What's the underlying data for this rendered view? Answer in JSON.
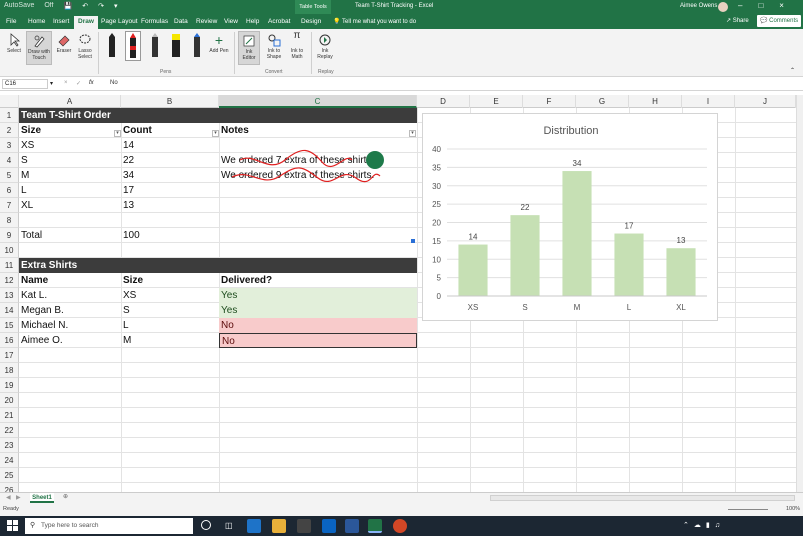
{
  "title_bar": {
    "autosave": "AutoSave",
    "autosave_state": "Off",
    "context_tab": "Table Tools",
    "title": "Team T-Shirt Tracking - Excel",
    "user": "Aimee Owens"
  },
  "tabs": [
    "File",
    "Home",
    "Insert",
    "Draw",
    "Page Layout",
    "Formulas",
    "Data",
    "Review",
    "View",
    "Help",
    "Acrobat",
    "Design"
  ],
  "active_tab": "Draw",
  "tell_me": "Tell me what you want to do",
  "share": "Share",
  "comments": "Comments",
  "ribbon": {
    "select": "Select",
    "draw_touch": "Draw with Touch",
    "eraser": "Eraser",
    "lasso": "Lasso Select",
    "add_pen": "Add Pen",
    "ink_editor": "Ink Editor",
    "ink_shape": "Ink to Shape",
    "ink_math": "Ink to Math",
    "ink_replay": "Ink Replay",
    "groups": {
      "pens": "Pens",
      "convert": "Convert",
      "replay": "Replay"
    }
  },
  "formula_bar": {
    "name_box": "C16",
    "value": "No"
  },
  "columns": [
    "A",
    "B",
    "C",
    "D",
    "E",
    "F",
    "G",
    "H",
    "I",
    "J"
  ],
  "rows": [
    "1",
    "2",
    "3",
    "4",
    "5",
    "6",
    "7",
    "8",
    "9",
    "10",
    "11",
    "12",
    "13",
    "14",
    "15",
    "16",
    "17",
    "18",
    "19",
    "20",
    "21",
    "22",
    "23",
    "24",
    "25",
    "26"
  ],
  "table1": {
    "title": "Team T-Shirt Order",
    "headers": [
      "Size",
      "Count",
      "Notes"
    ],
    "rows": [
      [
        "XS",
        "14",
        ""
      ],
      [
        "S",
        "22",
        "We ordered 7 extra of these shirts."
      ],
      [
        "M",
        "34",
        "We ordered 9 extra of these shirts."
      ],
      [
        "L",
        "17",
        ""
      ],
      [
        "XL",
        "13",
        ""
      ]
    ],
    "total_label": "Total",
    "total_value": "100"
  },
  "table2": {
    "title": "Extra Shirts",
    "headers": [
      "Name",
      "Size",
      "Delivered?"
    ],
    "rows": [
      [
        "Kat L.",
        "XS",
        "Yes"
      ],
      [
        "Megan B.",
        "S",
        "Yes"
      ],
      [
        "Michael N.",
        "L",
        "No"
      ],
      [
        "Aimee O.",
        "M",
        "No"
      ]
    ]
  },
  "chart_data": {
    "type": "bar",
    "title": "Distribution",
    "categories": [
      "XS",
      "S",
      "M",
      "L",
      "XL"
    ],
    "values": [
      14,
      22,
      34,
      17,
      13
    ],
    "ylim": [
      0,
      40
    ],
    "yticks": [
      0,
      5,
      10,
      15,
      20,
      25,
      30,
      35,
      40
    ],
    "grid": true,
    "legend": "none",
    "bar_color": "#c6e0b4"
  },
  "sheet": "Sheet1",
  "status": "Ready",
  "zoom": "100%",
  "taskbar": {
    "search": "Type here to search"
  },
  "colors": {
    "excel_green": "#217346",
    "ink_red": "#e02020",
    "cursor_green": "#1e7a4a"
  }
}
